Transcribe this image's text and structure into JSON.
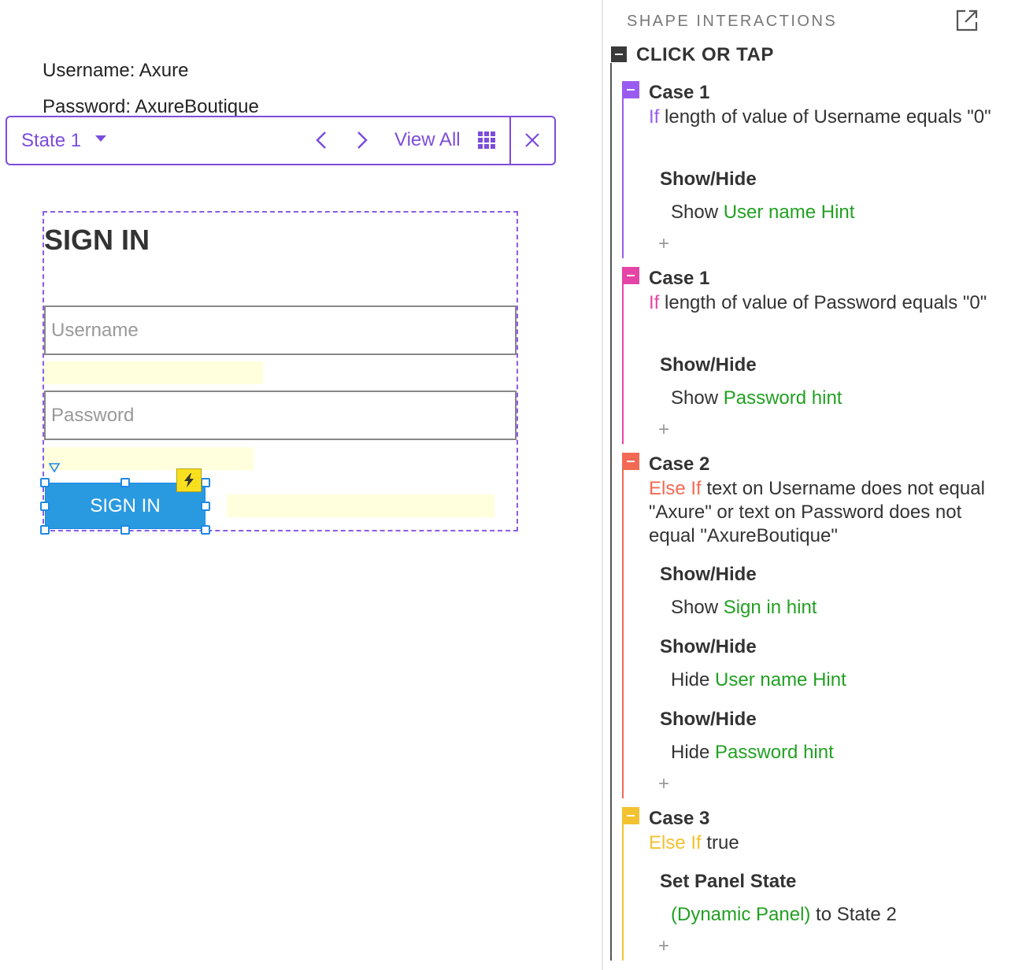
{
  "canvas": {
    "notes": {
      "username": "Username: Axure",
      "password": "Password: AxureBoutique"
    },
    "state_toolbar": {
      "state_label": "State 1",
      "view_all_label": "View All"
    },
    "form": {
      "title": "SIGN IN",
      "username_placeholder": "Username",
      "password_placeholder": "Password",
      "button_label": "SIGN IN"
    }
  },
  "interactions": {
    "title": "SHAPE INTERACTIONS",
    "event": {
      "label": "CLICK OR TAP"
    },
    "cases": [
      {
        "name": "Case 1",
        "color": "#9a5cf0",
        "keyword": "If",
        "condition": " length of value of Username equals \"0\"",
        "actions": [
          {
            "name": "Show/Hide",
            "verb": "Show",
            "target": "User name Hint"
          }
        ],
        "add_symbol": "+"
      },
      {
        "name": "Case 1",
        "color": "#e545a6",
        "keyword": "If",
        "condition": " length of value of Password equals \"0\"",
        "actions": [
          {
            "name": "Show/Hide",
            "verb": "Show",
            "target": "Password hint"
          }
        ],
        "add_symbol": "+"
      },
      {
        "name": "Case 2",
        "color": "#f26a54",
        "keyword": "Else If",
        "condition": " text on Username does not equal \"Axure\" or text on Password does not equal \"AxureBoutique\"",
        "actions": [
          {
            "name": "Show/Hide",
            "verb": "Show",
            "target": "Sign in hint"
          },
          {
            "name": "Show/Hide",
            "verb": "Hide",
            "target": "User name Hint"
          },
          {
            "name": "Show/Hide",
            "verb": "Hide",
            "target": "Password hint"
          }
        ],
        "add_symbol": "+"
      },
      {
        "name": "Case 3",
        "color": "#f2c230",
        "keyword": "Else If",
        "condition": " true",
        "actions": [
          {
            "name": "Set Panel State",
            "target": "(Dynamic Panel)",
            "suffix": " to State 2"
          }
        ],
        "add_symbol": "+"
      }
    ]
  },
  "colors": {
    "accent_purple": "#7c4ddb",
    "button_blue": "#2a9ae0",
    "hint_yellow": "#ffffdd",
    "target_green": "#22a022"
  },
  "icons": [
    "chevron-down-icon",
    "chevron-left-icon",
    "chevron-right-icon",
    "grid-icon",
    "close-icon",
    "lightning-icon",
    "popout-icon",
    "collapse-icon",
    "anchor-icon"
  ]
}
